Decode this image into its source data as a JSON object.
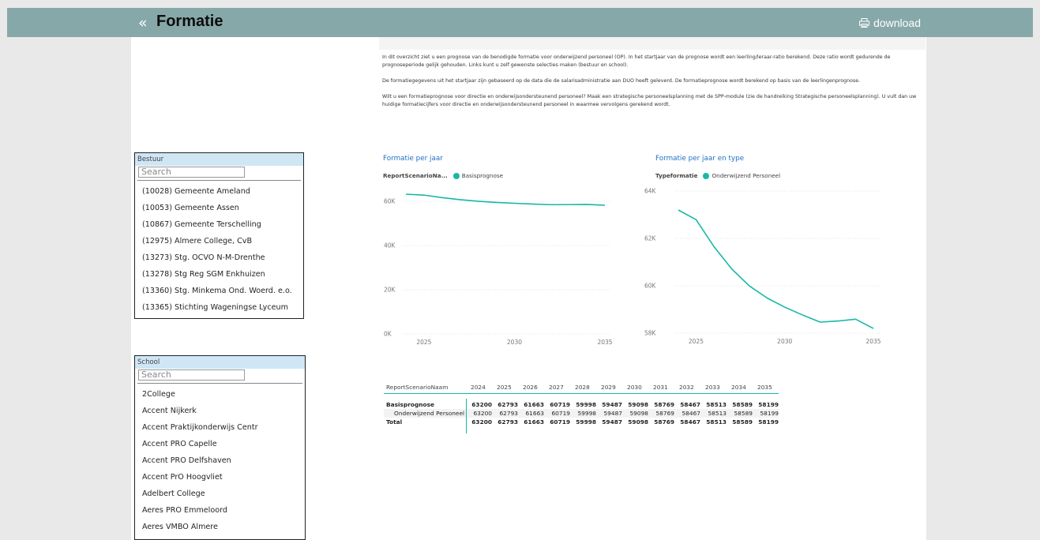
{
  "header": {
    "back_symbol": "«",
    "title": "Formatie",
    "download_label": "download"
  },
  "intro": {
    "p1": "In dit overzicht ziet u een prognose van de benodigde formatie voor onderwijzend personeel (OP). In het startjaar van de prognose wordt een leerling/leraar-ratio berekend. Deze ratio wordt gedurende de prognoseperiode gelijk gehouden. Links kunt u zelf gewenste selecties maken (bestuur en school).",
    "p2": "De formatiegegevens uit het startjaar zijn gebaseerd op de data die de salarisadministratie aan DUO heeft geleverd. De formatieprognose wordt berekend op basis van de leerlingenprognose.",
    "p3": "Wilt u een formatieprognose voor directie en onderwijsondersteunend personeel? Maak een strategische personeelsplanning met de SPP-module (zie de handreiking Strategische personeelsplanning). U vult dan uw huidige formatiecijfers voor directie en onderwijsondersteunend personeel in waarmee vervolgens gerekend wordt."
  },
  "slicers": {
    "bestuur": {
      "title": "Bestuur",
      "placeholder": "Search",
      "items": [
        "(10028) Gemeente Ameland",
        "(10053) Gemeente Assen",
        "(10867) Gemeente Terschelling",
        "(12975) Almere College, CvB",
        "(13273) Stg. OCVO N-M-Drenthe",
        "(13278) Stg Reg SGM Enkhuizen",
        "(13360) Stg. Minkema Ond. Woerd. e.o.",
        "(13365) Stichting Wageningse Lyceum"
      ]
    },
    "school": {
      "title": "School",
      "placeholder": "Search",
      "items": [
        "2College",
        "Accent Nijkerk",
        "Accent Praktijkonderwijs Centr",
        "Accent PRO Capelle",
        "Accent PRO Delfshaven",
        "Accent PrO Hoogvliet",
        "Adelbert College",
        "Aeres PRO Emmeloord",
        "Aeres VMBO Almere"
      ]
    }
  },
  "visual1": {
    "title": "Formatie per jaar",
    "legend_field": "ReportScenarioNa...",
    "legend_item": "Basisprognose"
  },
  "visual2": {
    "title": "Formatie per jaar en type",
    "legend_field": "Typeformatie",
    "legend_item": "Onderwijzend Personeel"
  },
  "colors": {
    "series": "#17b8a6",
    "header_bar": "#87a8a9",
    "title_blue": "#1f6fc6"
  },
  "chart_data": [
    {
      "type": "line",
      "title": "Formatie per jaar",
      "x": [
        2024,
        2025,
        2026,
        2027,
        2028,
        2029,
        2030,
        2031,
        2032,
        2033,
        2034,
        2035
      ],
      "series": [
        {
          "name": "Basisprognose",
          "values": [
            63200,
            62793,
            61663,
            60719,
            59998,
            59487,
            59098,
            58769,
            58467,
            58513,
            58589,
            58199
          ]
        }
      ],
      "xticks": [
        2025,
        2030,
        2035
      ],
      "yticks": [
        0,
        20000,
        40000,
        60000
      ],
      "ytick_labels": [
        "0K",
        "20K",
        "40K",
        "60K"
      ],
      "ylim": [
        0,
        63200
      ],
      "legend": "top-left"
    },
    {
      "type": "line",
      "title": "Formatie per jaar en type",
      "x": [
        2024,
        2025,
        2026,
        2027,
        2028,
        2029,
        2030,
        2031,
        2032,
        2033,
        2034,
        2035
      ],
      "series": [
        {
          "name": "Onderwijzend Personeel",
          "values": [
            63200,
            62793,
            61663,
            60719,
            59998,
            59487,
            59098,
            58769,
            58467,
            58513,
            58589,
            58199
          ]
        }
      ],
      "xticks": [
        2025,
        2030,
        2035
      ],
      "yticks": [
        58000,
        60000,
        62000,
        64000
      ],
      "ytick_labels": [
        "58K",
        "60K",
        "62K",
        "64K"
      ],
      "ylim": [
        58000,
        64000
      ],
      "legend": "top-left"
    }
  ],
  "matrix": {
    "corner": "ReportScenarioNaam",
    "years": [
      "2024",
      "2025",
      "2026",
      "2027",
      "2028",
      "2029",
      "2030",
      "2031",
      "2032",
      "2033",
      "2034",
      "2035"
    ],
    "rows": [
      {
        "label": "Basisprognose",
        "values": [
          "63200",
          "62793",
          "61663",
          "60719",
          "59998",
          "59487",
          "59098",
          "58769",
          "58467",
          "58513",
          "58589",
          "58199"
        ]
      },
      {
        "label": "Onderwijzend Personeel",
        "values": [
          "63200",
          "62793",
          "61663",
          "60719",
          "59998",
          "59487",
          "59098",
          "58769",
          "58467",
          "58513",
          "58589",
          "58199"
        ]
      },
      {
        "label": "Total",
        "values": [
          "63200",
          "62793",
          "61663",
          "60719",
          "59998",
          "59487",
          "59098",
          "58769",
          "58467",
          "58513",
          "58589",
          "58199"
        ]
      }
    ]
  }
}
